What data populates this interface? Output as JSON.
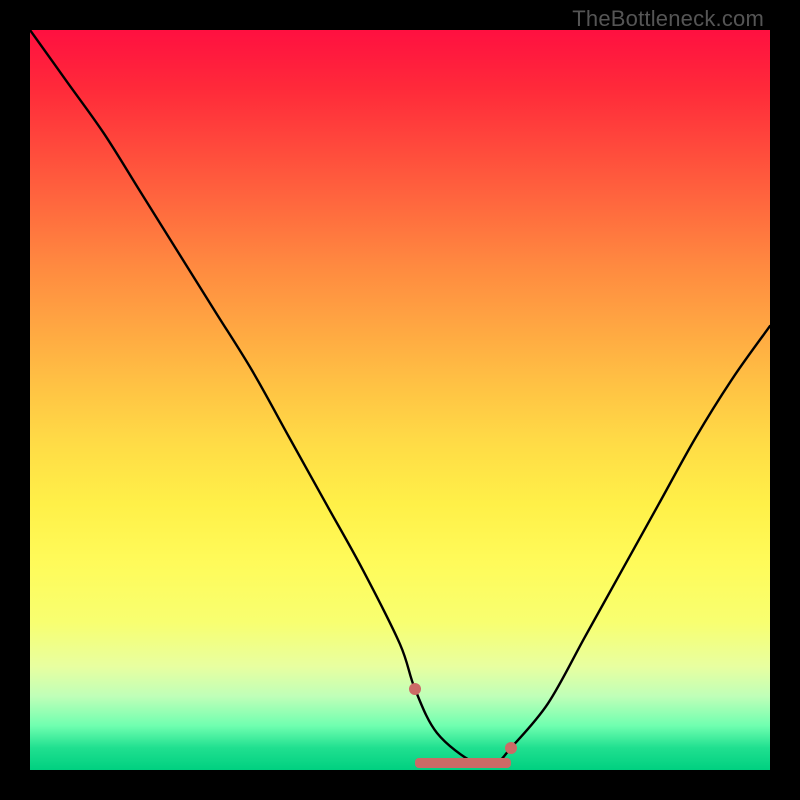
{
  "watermark": "TheBottleneck.com",
  "chart_data": {
    "type": "line",
    "title": "",
    "xlabel": "",
    "ylabel": "",
    "xlim": [
      0,
      100
    ],
    "ylim": [
      0,
      100
    ],
    "series": [
      {
        "name": "curve",
        "x": [
          0,
          5,
          10,
          15,
          20,
          25,
          30,
          35,
          40,
          45,
          50,
          52,
          55,
          60,
          63,
          65,
          70,
          75,
          80,
          85,
          90,
          95,
          100
        ],
        "values": [
          100,
          93,
          86,
          78,
          70,
          62,
          54,
          45,
          36,
          27,
          17,
          11,
          5,
          1,
          1,
          3,
          9,
          18,
          27,
          36,
          45,
          53,
          60
        ]
      }
    ],
    "highlight": {
      "x_start": 52,
      "x_end": 65,
      "note": "flat low segment near minimum, tinted band with endpoint dots"
    },
    "background_gradient_note": "vertical heat gradient: red (top/high) through orange/yellow to green (bottom/low)"
  }
}
